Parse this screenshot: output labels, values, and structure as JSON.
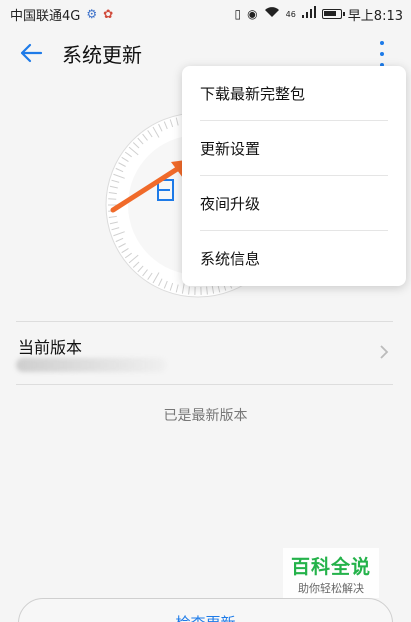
{
  "status_bar": {
    "carrier": "中国联通4G",
    "network_badge": "46",
    "time": "早上8:13",
    "icons": [
      "vibrate-icon",
      "eye-icon",
      "wifi-icon",
      "signal-icon",
      "battery-icon"
    ]
  },
  "app_bar": {
    "title": "系统更新",
    "back_icon": "back-arrow-icon",
    "more_icon": "more-vert-icon"
  },
  "menu": {
    "items": [
      "下载最新完整包",
      "更新设置",
      "夜间升级",
      "系统信息"
    ]
  },
  "version": {
    "label": "当前版本",
    "chevron_icon": "chevron-right-icon"
  },
  "status_text": "已是最新版本",
  "watermark": {
    "title": "百科全说",
    "subtitle": "助你轻松解决"
  },
  "check_button_label": "检查更新",
  "colors": {
    "accent": "#1e7be8",
    "arrow": "#f06a2a",
    "watermark": "#24b24a"
  }
}
